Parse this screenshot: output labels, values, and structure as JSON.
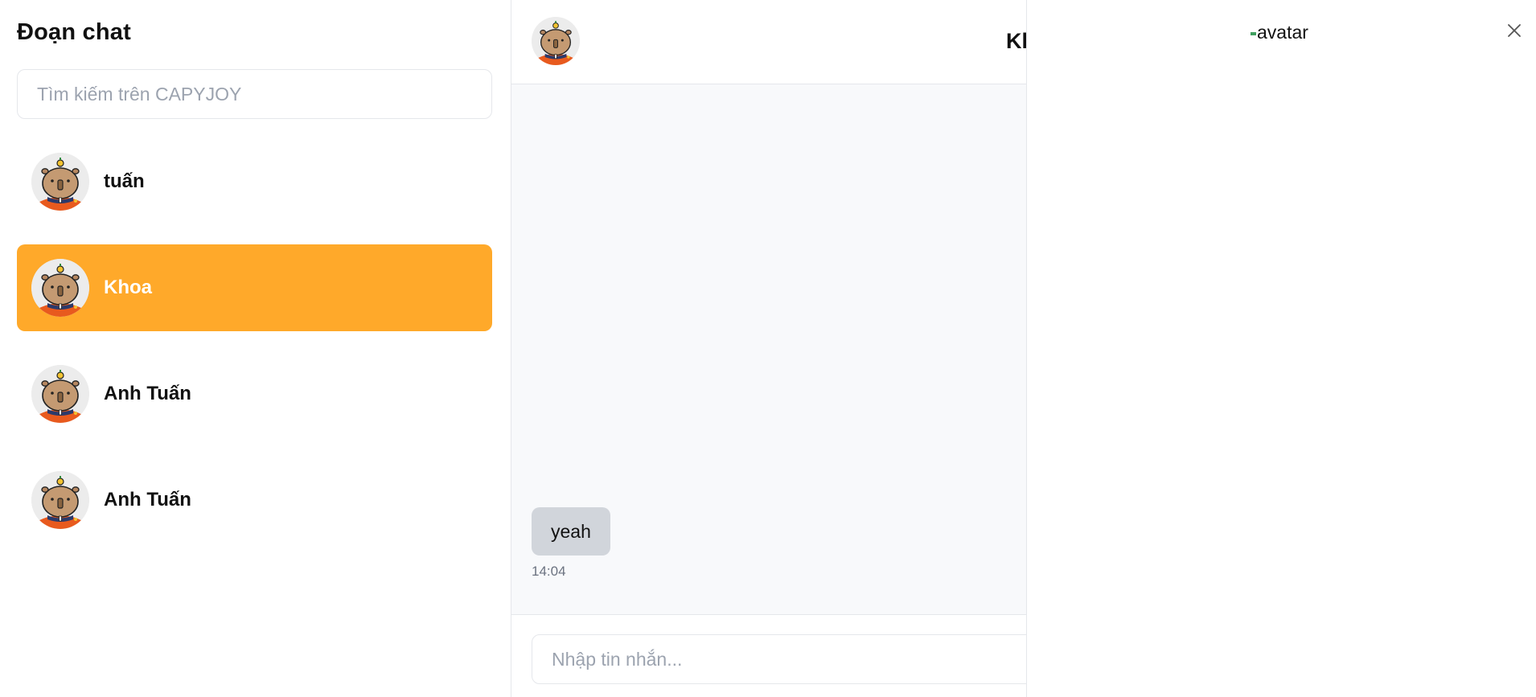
{
  "sidebar": {
    "title": "Đoạn chat",
    "search": {
      "placeholder": "Tìm kiếm trên CAPYJOY",
      "value": ""
    },
    "conversations": [
      {
        "name": "tuấn",
        "active": false
      },
      {
        "name": "Khoa",
        "active": true
      },
      {
        "name": "Anh Tuấn",
        "active": false
      },
      {
        "name": "Anh Tuấn",
        "active": false
      }
    ]
  },
  "chat": {
    "header": {
      "title": "Khoa"
    },
    "messages": [
      {
        "text": "yeah",
        "time": "14:04"
      }
    ],
    "composer": {
      "placeholder": "Nhập tin nhắn...",
      "value": ""
    }
  },
  "panel": {
    "avatar_alt": "avatar",
    "close_icon": "close-icon"
  },
  "colors": {
    "accent": "#ffa92a",
    "bubble": "#d1d5db",
    "message_area": "#f8f9fb",
    "border": "#e5e7eb"
  }
}
